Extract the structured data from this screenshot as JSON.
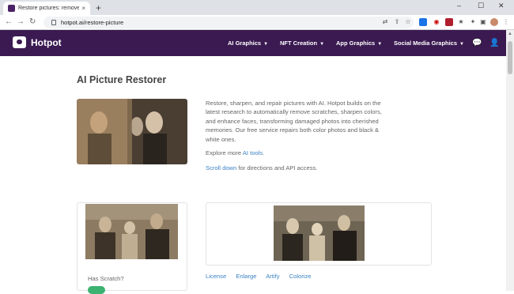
{
  "browser": {
    "tab_title": "Restore pictures: remove scratch",
    "tab_close": "×",
    "new_tab": "+",
    "url": "hotpot.ai/restore-picture",
    "win_min": "–",
    "win_max": "☐",
    "win_close": "✕"
  },
  "site": {
    "brand": "Hotpot",
    "menu": [
      {
        "label": "AI Graphics"
      },
      {
        "label": "NFT Creation"
      },
      {
        "label": "App Graphics"
      },
      {
        "label": "Social Media Graphics"
      }
    ]
  },
  "page": {
    "title": "AI Picture Restorer",
    "description": "Restore, sharpen, and repair pictures with AI. Hotpot builds on the latest research to automatically remove scratches, sharpen colors, and enhance faces, transforming damaged photos into cherished memories. Our free service repairs both color photos and black & white ones.",
    "explore_prefix": "Explore more ",
    "explore_link": "AI tools",
    "explore_suffix": ".",
    "scroll_link": "Scroll down",
    "scroll_suffix": " for directions and API access.",
    "has_scratch_label": "Has Scratch?",
    "bottom_links": [
      "License",
      "Enlarge",
      "Artify",
      "Colorize"
    ]
  },
  "colors": {
    "nav_bg": "#3b1a52",
    "link": "#3b82c4",
    "toggle_on": "#3cb371"
  }
}
